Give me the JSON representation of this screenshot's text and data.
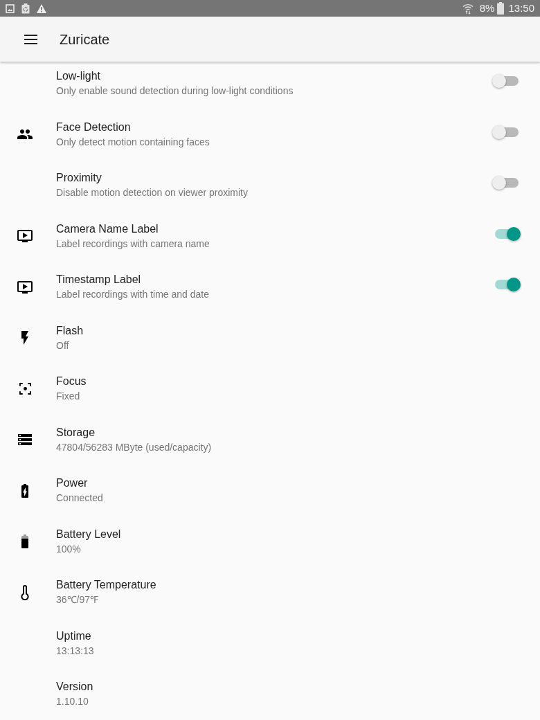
{
  "status_bar": {
    "battery_percent": "8%",
    "time": "13:50"
  },
  "app_bar": {
    "title": "Zuricate"
  },
  "settings": [
    {
      "kind": "toggle",
      "title": "Low-light",
      "summary": "Only enable sound detection during low-light conditions",
      "on": false
    },
    {
      "kind": "toggle",
      "title": "Face Detection",
      "summary": "Only detect motion containing faces",
      "on": false
    },
    {
      "kind": "toggle",
      "title": "Proximity",
      "summary": "Disable motion detection on viewer proximity",
      "on": false
    },
    {
      "kind": "toggle",
      "title": "Camera Name Label",
      "summary": "Label recordings with camera name",
      "on": true
    },
    {
      "kind": "toggle",
      "title": "Timestamp Label",
      "summary": "Label recordings with time and date",
      "on": true
    },
    {
      "kind": "info",
      "title": "Flash",
      "summary": "Off"
    },
    {
      "kind": "info",
      "title": "Focus",
      "summary": "Fixed"
    },
    {
      "kind": "info",
      "title": "Storage",
      "summary": "47804/56283 MByte (used/capacity)"
    },
    {
      "kind": "info",
      "title": "Power",
      "summary": "Connected"
    },
    {
      "kind": "info",
      "title": "Battery Level",
      "summary": "100%"
    },
    {
      "kind": "info",
      "title": "Battery Temperature",
      "summary": "36℃/97℉"
    },
    {
      "kind": "info",
      "title": "Uptime",
      "summary": "13:13:13"
    },
    {
      "kind": "info",
      "title": "Version",
      "summary": "1.10.10"
    }
  ]
}
